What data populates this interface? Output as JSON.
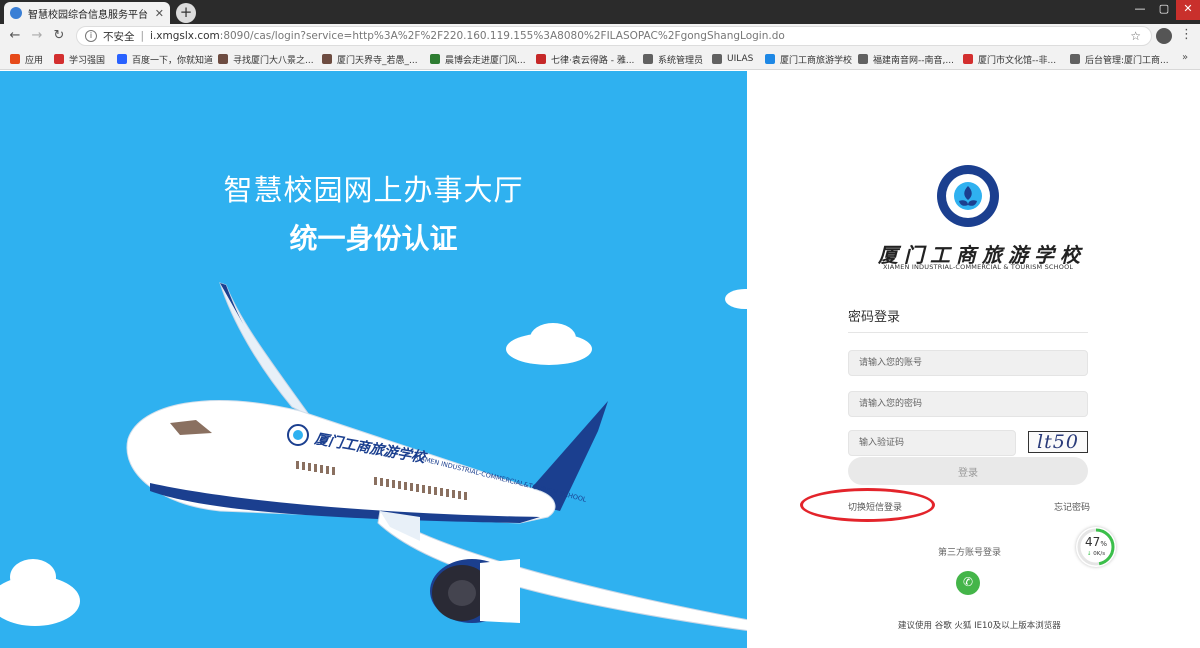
{
  "browser": {
    "tab_title": "智慧校园综合信息服务平台",
    "new_tab": "+",
    "insecure_label": "不安全",
    "url_domain": "i.xmgslx.com",
    "url_rest": ":8090/cas/login?service=http%3A%2F%2F220.160.119.155%3A8080%2FILASOPAC%2FgongShangLogin.do",
    "bookmarks": [
      {
        "label": "应用",
        "color": "#e64a19"
      },
      {
        "label": "学习强国",
        "color": "#d32f2f"
      },
      {
        "label": "百度一下，你就知道",
        "color": "#2962ff"
      },
      {
        "label": "寻找厦门大八景之...",
        "color": "#6d4c41"
      },
      {
        "label": "厦门天界寺_若愚_...",
        "color": "#6d4c41"
      },
      {
        "label": "晨博会走进厦门风...",
        "color": "#2e7d32"
      },
      {
        "label": "七律·袁云得路 - 雅...",
        "color": "#c62828"
      },
      {
        "label": "系统管理员",
        "color": "#616161"
      },
      {
        "label": "UILAS",
        "color": "#616161"
      },
      {
        "label": "厦门工商旅游学校",
        "color": "#1e88e5"
      },
      {
        "label": "福建南音网--南音,...",
        "color": "#616161"
      },
      {
        "label": "厦门市文化馆--非...",
        "color": "#d32f2f"
      },
      {
        "label": "后台管理:厦门工商...",
        "color": "#616161"
      }
    ]
  },
  "hero": {
    "title": "智慧校园网上办事大厅",
    "subtitle": "统一身份认证",
    "plane_school_cn": "厦门工商旅游学校",
    "plane_school_en": "XIAMEN INDUSTRIAL-COMMERCIAL&TOURISM SCHOOL"
  },
  "login": {
    "school_name": "厦门工商旅游学校",
    "school_name_en": "XIAMEN INDUSTRIAL-COMMERCIAL & TOURISM SCHOOL",
    "title": "密码登录",
    "account_placeholder": "请输入您的账号",
    "password_placeholder": "请输入您的密码",
    "captcha_placeholder": "输入验证码",
    "captcha_text": "lt50",
    "login_button": "登录",
    "sms_login_link": "切换短信登录",
    "forgot_password_link": "忘记密码",
    "third_party_label": "第三方账号登录",
    "browser_tip": "建议使用 谷歌 火狐 IE10及以上版本浏览器"
  },
  "speed_widget": {
    "percent": "47",
    "percent_unit": "%",
    "rate": "0K/s"
  },
  "colors": {
    "hero_bg": "#2fb1f0",
    "plane_body": "#ffffff",
    "plane_tail": "#1b3f8f",
    "highlight_ring": "#e3242b",
    "wechat": "#44b549"
  }
}
